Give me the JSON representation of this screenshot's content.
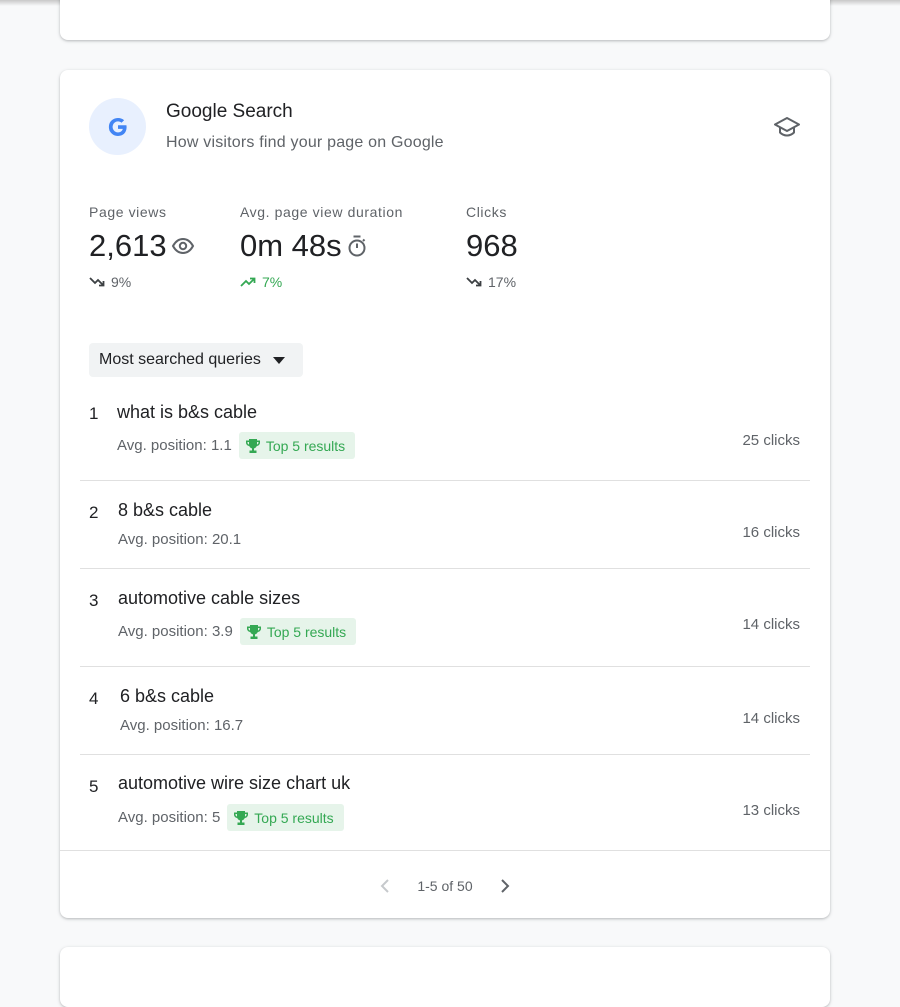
{
  "card": {
    "logo_letter": "G",
    "title": "Google Search",
    "subtitle": "How visitors find your page on Google"
  },
  "stats": [
    {
      "label": "Page views",
      "value": "2,613",
      "change": "9%",
      "trend": "down",
      "icon": "eye-icon"
    },
    {
      "label": "Avg. page view duration",
      "value": "0m 48s",
      "change": "7%",
      "trend": "up",
      "icon": "timer-icon"
    },
    {
      "label": "Clicks",
      "value": "968",
      "change": "17%",
      "trend": "down",
      "icon": ""
    }
  ],
  "queries_dropdown": {
    "label": "Most searched queries"
  },
  "queries": [
    {
      "rank": "1",
      "query": "what is b&s cable",
      "position": "Avg. position: 1.1",
      "badge": "Top 5 results",
      "clicks": "25 clicks"
    },
    {
      "rank": "2",
      "query": "8 b&s cable",
      "position": "Avg. position: 20.1",
      "badge": "",
      "clicks": "16 clicks"
    },
    {
      "rank": "3",
      "query": "automotive cable sizes",
      "position": "Avg. position: 3.9",
      "badge": "Top 5 results",
      "clicks": "14 clicks"
    },
    {
      "rank": "4",
      "query": "6 b&s cable",
      "position": "Avg. position: 16.7",
      "badge": "",
      "clicks": "14 clicks"
    },
    {
      "rank": "5",
      "query": "automotive wire size chart uk",
      "position": "Avg. position: 5",
      "badge": "Top 5 results",
      "clicks": "13 clicks"
    }
  ],
  "pagination": {
    "range": "1-5 of 50"
  },
  "colors": {
    "accent_blue": "#4285f4",
    "positive": "#34a853",
    "badge_bg": "#e6f4ea",
    "muted": "#5f6368"
  }
}
